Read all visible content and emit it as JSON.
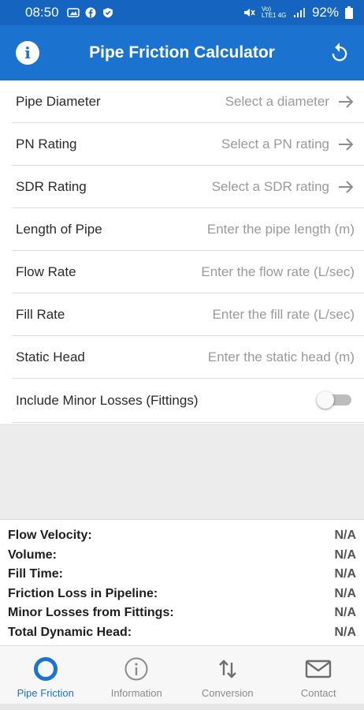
{
  "status_bar": {
    "time": "08:50",
    "battery": "92%",
    "signal_text": "Vo) LTE1 4G"
  },
  "app_bar": {
    "title": "Pipe Friction Calculator",
    "info_icon": "i",
    "color": "#1b73cf"
  },
  "form": {
    "rows": [
      {
        "label": "Pipe Diameter",
        "value": "Select a diameter"
      },
      {
        "label": "PN Rating",
        "value": "Select a PN rating"
      },
      {
        "label": "SDR Rating",
        "value": "Select a SDR rating"
      },
      {
        "label": "Length of Pipe",
        "value": "Enter the pipe length (m)"
      },
      {
        "label": "Flow Rate",
        "value": "Enter the flow rate (L/sec)"
      },
      {
        "label": "Fill Rate",
        "value": "Enter the fill rate (L/sec)"
      },
      {
        "label": "Static Head",
        "value": "Enter the static head (m)"
      }
    ],
    "minor_losses": {
      "label": "Include Minor Losses (Fittings)",
      "enabled": false
    }
  },
  "results": [
    {
      "label": "Flow Velocity:",
      "value": "N/A"
    },
    {
      "label": "Volume:",
      "value": "N/A"
    },
    {
      "label": "Fill Time:",
      "value": "N/A"
    },
    {
      "label": "Friction Loss in Pipeline:",
      "value": "N/A"
    },
    {
      "label": "Minor Losses from Fittings:",
      "value": "N/A"
    },
    {
      "label": "Total Dynamic Head:",
      "value": "N/A"
    }
  ],
  "bottom_nav": [
    {
      "label": "Pipe Friction",
      "icon": "circle-icon",
      "active": true
    },
    {
      "label": "Information",
      "icon": "info-icon",
      "active": false
    },
    {
      "label": "Conversion",
      "icon": "swap-vertical-icon",
      "active": false
    },
    {
      "label": "Contact",
      "icon": "mail-icon",
      "active": false
    }
  ]
}
